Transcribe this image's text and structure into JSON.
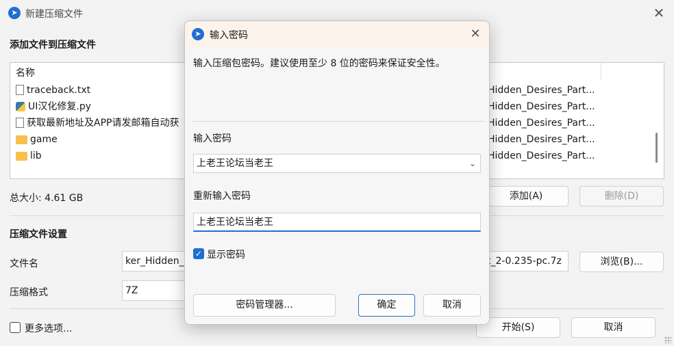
{
  "window": {
    "title": "新建压缩文件",
    "close_glyph": "✕"
  },
  "files_section": {
    "heading": "添加文件到压缩文件",
    "column_name": "名称",
    "items": [
      {
        "name": "traceback.txt",
        "icon": "text-file-icon"
      },
      {
        "name": "UI汉化修复.py",
        "icon": "python-file-icon"
      },
      {
        "name": "获取最新地址及APP请发邮箱自动获",
        "icon": "text-file-icon"
      },
      {
        "name": "game",
        "icon": "folder-icon"
      },
      {
        "name": "lib",
        "icon": "folder-icon"
      }
    ],
    "right_column": [
      "Hidden_Desires_Part...",
      "Hidden_Desires_Part...",
      "Hidden_Desires_Part...",
      "Hidden_Desires_Part...",
      "Hidden_Desires_Part..."
    ],
    "total_size": "总大小: 4.61 GB",
    "add_button": "添加(A)",
    "remove_button": "删除(D)"
  },
  "settings_section": {
    "heading": "压缩文件设置",
    "filename_label": "文件名",
    "filename_value_left": "ker_Hidden_",
    "filename_value_right": "t_2-0.235-pc.7z",
    "browse_button": "浏览(B)...",
    "format_label": "压缩格式",
    "format_value": "7Z"
  },
  "footer": {
    "more_options": "更多选项...",
    "start_button": "开始(S)",
    "cancel_button": "取消"
  },
  "modal": {
    "title": "输入密码",
    "close_glyph": "✕",
    "description": "输入压缩包密码。建议使用至少 8 位的密码来保证安全性。",
    "password_label": "输入密码",
    "password_value": "上老王论坛当老王",
    "reenter_label": "重新输入密码",
    "reenter_value": "上老王论坛当老王",
    "show_password": "显示密码",
    "show_password_checked": true,
    "manager_button": "密码管理器...",
    "ok_button": "确定",
    "cancel_button": "取消"
  },
  "colors": {
    "accent": "#1f6fd1",
    "modal_header": "#fcf3ea",
    "window_bg": "#f3f3f3"
  }
}
